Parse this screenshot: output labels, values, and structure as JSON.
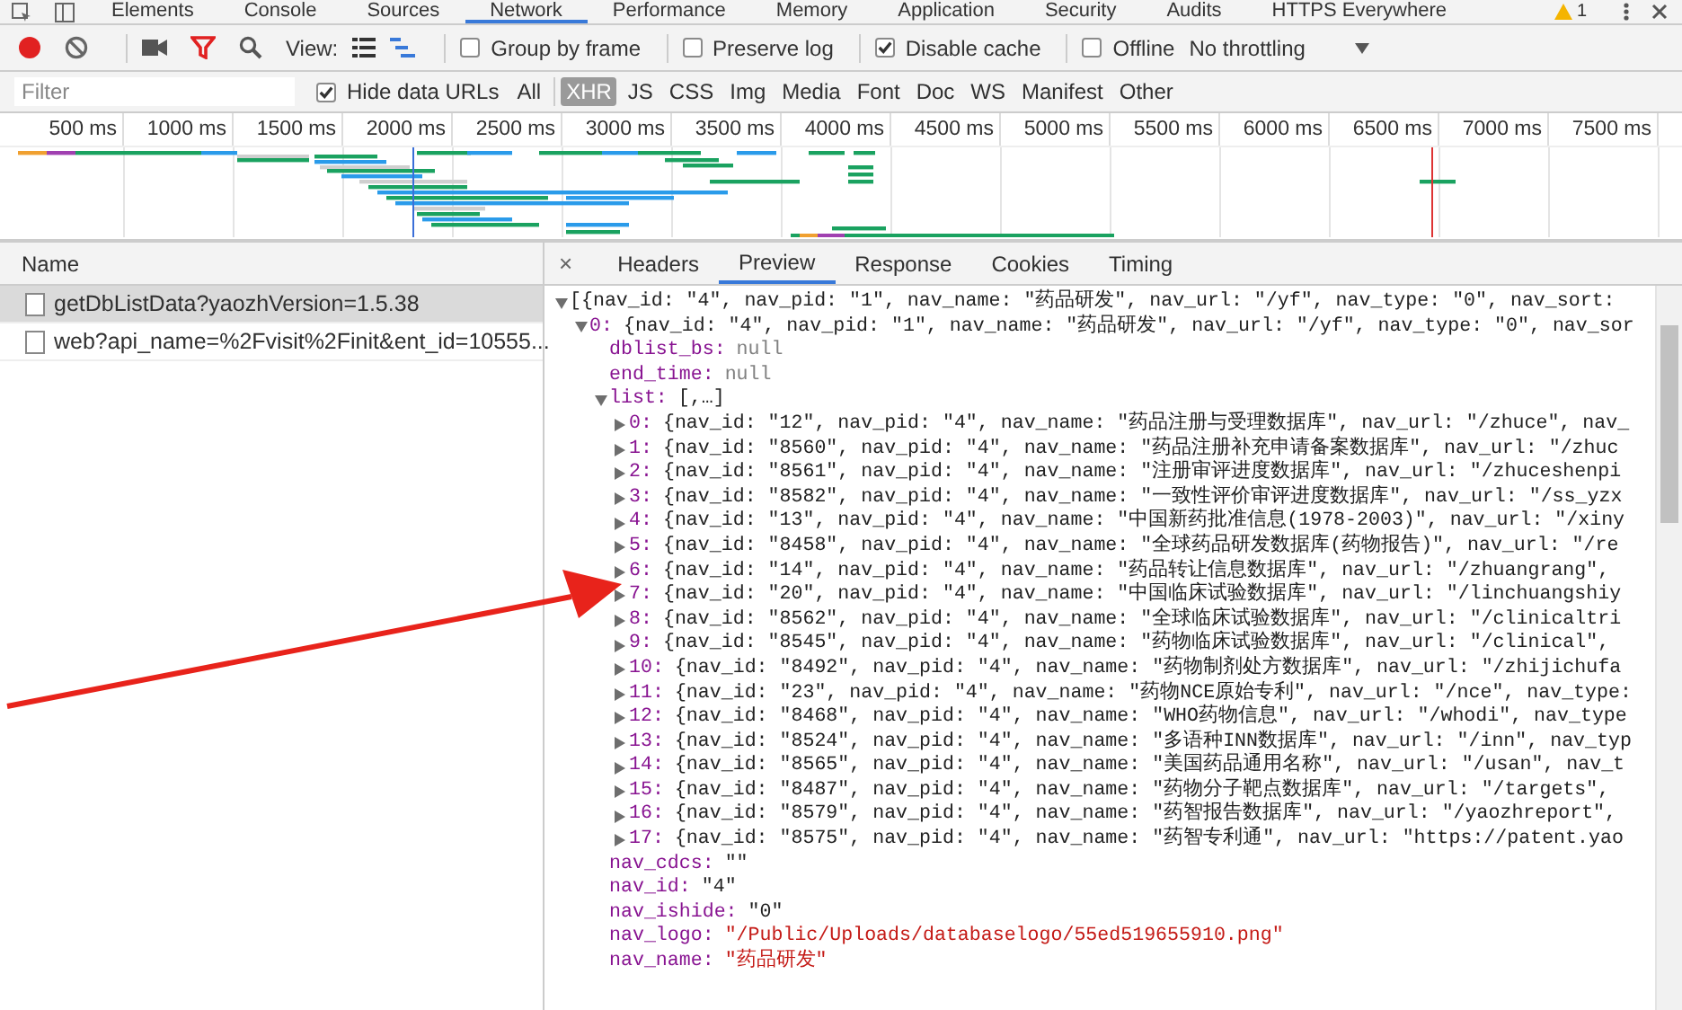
{
  "panel_tabs": [
    {
      "label": "Elements",
      "selected": false
    },
    {
      "label": "Console",
      "selected": false
    },
    {
      "label": "Sources",
      "selected": false
    },
    {
      "label": "Network",
      "selected": true
    },
    {
      "label": "Performance",
      "selected": false
    },
    {
      "label": "Memory",
      "selected": false
    },
    {
      "label": "Application",
      "selected": false
    },
    {
      "label": "Security",
      "selected": false
    },
    {
      "label": "Audits",
      "selected": false
    },
    {
      "label": "HTTPS Everywhere",
      "selected": false
    }
  ],
  "warning_count": "1",
  "toolbar": {
    "recording": true,
    "view_label": "View:",
    "view_buttons": [
      {
        "kind": "list",
        "selected": false
      },
      {
        "kind": "waterfall",
        "selected": true
      }
    ],
    "options": [
      {
        "label": "Group by frame",
        "checked": false
      },
      {
        "label": "Preserve log",
        "checked": false
      },
      {
        "label": "Disable cache",
        "checked": true
      },
      {
        "label": "Offline",
        "checked": false
      }
    ],
    "throttling": "No throttling"
  },
  "filter": {
    "placeholder": "Filter",
    "hide_data_urls": {
      "label": "Hide data URLs",
      "checked": true
    },
    "types": [
      {
        "label": "All",
        "selected": false
      },
      {
        "label": "XHR",
        "selected": true
      },
      {
        "label": "JS",
        "selected": false
      },
      {
        "label": "CSS",
        "selected": false
      },
      {
        "label": "Img",
        "selected": false
      },
      {
        "label": "Media",
        "selected": false
      },
      {
        "label": "Font",
        "selected": false
      },
      {
        "label": "Doc",
        "selected": false
      },
      {
        "label": "WS",
        "selected": false
      },
      {
        "label": "Manifest",
        "selected": false
      },
      {
        "label": "Other",
        "selected": false
      }
    ]
  },
  "overview": {
    "ticks": [
      "500 ms",
      "1000 ms",
      "1500 ms",
      "2000 ms",
      "2500 ms",
      "3000 ms",
      "3500 ms",
      "4000 ms",
      "4500 ms",
      "5000 ms",
      "5500 ms",
      "6000 ms",
      "6500 ms",
      "7000 ms",
      "7500 ms"
    ]
  },
  "requests": {
    "header": "Name",
    "rows": [
      {
        "name": "getDbListData?yaozhVersion=1.5.38",
        "selected": true
      },
      {
        "name": "web?api_name=%2Fvisit%2Finit&ent_id=10555...",
        "selected": false
      }
    ]
  },
  "details": {
    "close": "×",
    "tabs": [
      {
        "label": "Headers",
        "selected": false
      },
      {
        "label": "Preview",
        "selected": true
      },
      {
        "label": "Response",
        "selected": false
      },
      {
        "label": "Cookies",
        "selected": false
      },
      {
        "label": "Timing",
        "selected": false
      }
    ],
    "tree": [
      {
        "value": "[{nav_id: \"4\", nav_pid: \"1\", nav_name: \"药品研发\", nav_url: \"/yf\", nav_type: \"0\", nav_sort:",
        "expanded": true,
        "children": [
          {
            "key": "0:",
            "value": "{nav_id: \"4\", nav_pid: \"1\", nav_name: \"药品研发\", nav_url: \"/yf\", nav_type: \"0\", nav_sor",
            "expanded": true,
            "children": [
              {
                "key": "dblist_bs:",
                "value": "null",
                "kind": "null"
              },
              {
                "key": "end_time:",
                "value": "null",
                "kind": "null"
              },
              {
                "key": "list:",
                "value": "[,…]",
                "expanded": true,
                "children": [
                  {
                    "key": "0:",
                    "value": "{nav_id: \"12\", nav_pid: \"4\", nav_name: \"药品注册与受理数据库\", nav_url: \"/zhuce\", nav_",
                    "expanded": false
                  },
                  {
                    "key": "1:",
                    "value": "{nav_id: \"8560\", nav_pid: \"4\", nav_name: \"药品注册补充申请备案数据库\", nav_url: \"/zhuc",
                    "expanded": false
                  },
                  {
                    "key": "2:",
                    "value": "{nav_id: \"8561\", nav_pid: \"4\", nav_name: \"注册审评进度数据库\", nav_url: \"/zhuceshenpi",
                    "expanded": false
                  },
                  {
                    "key": "3:",
                    "value": "{nav_id: \"8582\", nav_pid: \"4\", nav_name: \"一致性评价审评进度数据库\", nav_url: \"/ss_yzx",
                    "expanded": false
                  },
                  {
                    "key": "4:",
                    "value": "{nav_id: \"13\", nav_pid: \"4\", nav_name: \"中国新药批准信息(1978-2003)\", nav_url: \"/xiny",
                    "expanded": false
                  },
                  {
                    "key": "5:",
                    "value": "{nav_id: \"8458\", nav_pid: \"4\", nav_name: \"全球药品研发数据库(药物报告)\", nav_url: \"/re",
                    "expanded": false
                  },
                  {
                    "key": "6:",
                    "value": "{nav_id: \"14\", nav_pid: \"4\", nav_name: \"药品转让信息数据库\", nav_url: \"/zhuangrang\",",
                    "expanded": false
                  },
                  {
                    "key": "7:",
                    "value": "{nav_id: \"20\", nav_pid: \"4\", nav_name: \"中国临床试验数据库\", nav_url: \"/linchuangshiy",
                    "expanded": false
                  },
                  {
                    "key": "8:",
                    "value": "{nav_id: \"8562\", nav_pid: \"4\", nav_name: \"全球临床试验数据库\", nav_url: \"/clinicaltri",
                    "expanded": false
                  },
                  {
                    "key": "9:",
                    "value": "{nav_id: \"8545\", nav_pid: \"4\", nav_name: \"药物临床试验数据库\", nav_url: \"/clinical\",",
                    "expanded": false
                  },
                  {
                    "key": "10:",
                    "value": "{nav_id: \"8492\", nav_pid: \"4\", nav_name: \"药物制剂处方数据库\", nav_url: \"/zhijichufa",
                    "expanded": false
                  },
                  {
                    "key": "11:",
                    "value": "{nav_id: \"23\", nav_pid: \"4\", nav_name: \"药物NCE原始专利\", nav_url: \"/nce\", nav_type:",
                    "expanded": false
                  },
                  {
                    "key": "12:",
                    "value": "{nav_id: \"8468\", nav_pid: \"4\", nav_name: \"WHO药物信息\", nav_url: \"/whodi\", nav_type",
                    "expanded": false
                  },
                  {
                    "key": "13:",
                    "value": "{nav_id: \"8524\", nav_pid: \"4\", nav_name: \"多语种INN数据库\", nav_url: \"/inn\", nav_typ",
                    "expanded": false
                  },
                  {
                    "key": "14:",
                    "value": "{nav_id: \"8565\", nav_pid: \"4\", nav_name: \"美国药品通用名称\", nav_url: \"/usan\", nav_t",
                    "expanded": false
                  },
                  {
                    "key": "15:",
                    "value": "{nav_id: \"8487\", nav_pid: \"4\", nav_name: \"药物分子靶点数据库\", nav_url: \"/targets\",",
                    "expanded": false
                  },
                  {
                    "key": "16:",
                    "value": "{nav_id: \"8579\", nav_pid: \"4\", nav_name: \"药智报告数据库\", nav_url: \"/yaozhreport\",",
                    "expanded": false
                  },
                  {
                    "key": "17:",
                    "value": "{nav_id: \"8575\", nav_pid: \"4\", nav_name: \"药智专利通\", nav_url: \"https://patent.yao",
                    "expanded": false
                  }
                ]
              },
              {
                "key": "nav_cdcs:",
                "value": "\"\""
              },
              {
                "key": "nav_id:",
                "value": "\"4\""
              },
              {
                "key": "nav_ishide:",
                "value": "\"0\""
              },
              {
                "key": "nav_logo:",
                "value": "\"/Public/Uploads/databaselogo/55ed519655910.png\"",
                "kind": "string"
              },
              {
                "key": "nav_name:",
                "value": "\"药品研发\"",
                "kind": "string"
              }
            ]
          }
        ]
      }
    ]
  }
}
